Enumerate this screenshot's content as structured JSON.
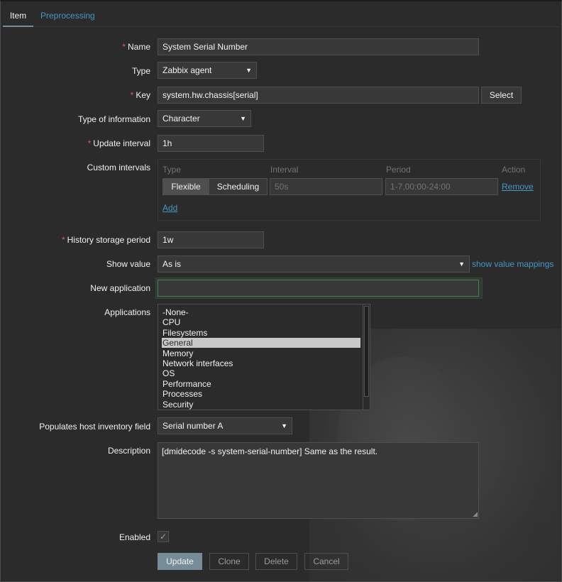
{
  "tabs": [
    {
      "label": "Item",
      "active": true
    },
    {
      "label": "Preprocessing",
      "active": false
    }
  ],
  "form": {
    "name": {
      "label": "Name",
      "required": true,
      "value": "System Serial Number"
    },
    "type": {
      "label": "Type",
      "value": "Zabbix agent"
    },
    "key": {
      "label": "Key",
      "required": true,
      "value": "system.hw.chassis[serial]",
      "select_label": "Select"
    },
    "type_of_information": {
      "label": "Type of information",
      "value": "Character"
    },
    "update_interval": {
      "label": "Update interval",
      "required": true,
      "value": "1h"
    },
    "custom_intervals": {
      "label": "Custom intervals",
      "headers": {
        "type": "Type",
        "interval": "Interval",
        "period": "Period",
        "action": "Action"
      },
      "row": {
        "flexible": "Flexible",
        "scheduling": "Scheduling",
        "interval": "50s",
        "period": "1-7,00:00-24:00",
        "remove": "Remove"
      },
      "add_label": "Add"
    },
    "history": {
      "label": "History storage period",
      "required": true,
      "value": "1w"
    },
    "show_value": {
      "label": "Show value",
      "value": "As is",
      "mappings_link": "show value mappings"
    },
    "new_application": {
      "label": "New application",
      "value": ""
    },
    "applications": {
      "label": "Applications",
      "items": [
        "-None-",
        "CPU",
        "Filesystems",
        "General",
        "Memory",
        "Network interfaces",
        "OS",
        "Performance",
        "Processes",
        "Security"
      ],
      "selected_index": 3
    },
    "inventory": {
      "label": "Populates host inventory field",
      "value": "Serial number A"
    },
    "description": {
      "label": "Description",
      "value": "[dmidecode -s system-serial-number] Same as the result."
    },
    "enabled": {
      "label": "Enabled",
      "checked": true
    }
  },
  "buttons": {
    "update": "Update",
    "clone": "Clone",
    "delete": "Delete",
    "cancel": "Cancel"
  },
  "colors": {
    "background": "#2b2b2b",
    "input": "#383838",
    "border": "#4f4f4f",
    "link": "#4796c4",
    "primary": "#768d99",
    "required": "#e45959"
  },
  "icons": {
    "select_arrow": "triangle-down-icon",
    "checkbox": "checkmark-icon"
  }
}
